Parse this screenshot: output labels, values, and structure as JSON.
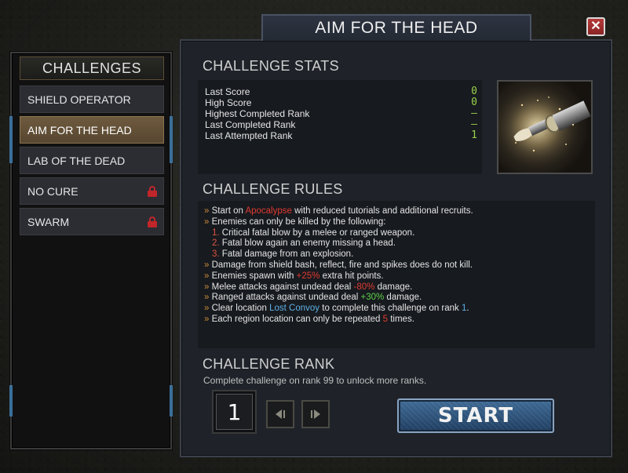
{
  "window": {
    "title": "AIM FOR THE HEAD",
    "close_label": "✕"
  },
  "sidebar": {
    "header": "CHALLENGES",
    "items": [
      {
        "label": "SHIELD OPERATOR",
        "locked": false,
        "active": false
      },
      {
        "label": "AIM FOR THE HEAD",
        "locked": false,
        "active": true
      },
      {
        "label": "LAB OF THE DEAD",
        "locked": false,
        "active": false
      },
      {
        "label": "NO CURE",
        "locked": true,
        "active": false
      },
      {
        "label": "SWARM",
        "locked": true,
        "active": false
      }
    ]
  },
  "stats": {
    "title": "CHALLENGE STATS",
    "rows": [
      {
        "label": "Last Score",
        "value": "0"
      },
      {
        "label": "High Score",
        "value": "0"
      },
      {
        "label": "Highest Completed Rank",
        "value": "–"
      },
      {
        "label": "Last Completed Rank",
        "value": "–"
      },
      {
        "label": "Last Attempted Rank",
        "value": "1"
      }
    ],
    "image_icon": "bullet-icon"
  },
  "rules": {
    "title": "CHALLENGE RULES",
    "bullet": "»",
    "r1": {
      "a": "Start on ",
      "b": "Apocalypse",
      "c": " with reduced tutorials and additional recruits."
    },
    "r2": "Enemies can only be killed by the following:",
    "sub1": {
      "n": "1.",
      "t": "Critical fatal blow by a melee or ranged weapon."
    },
    "sub2": {
      "n": "2.",
      "t": "Fatal blow again an enemy missing a head."
    },
    "sub3": {
      "n": "3.",
      "t": "Fatal damage from an explosion."
    },
    "r3": "Damage from shield bash, reflect, fire and spikes does do not kill.",
    "r4": {
      "a": "Enemies spawn with ",
      "b": "+25%",
      "c": " extra hit points."
    },
    "r5": {
      "a": "Melee attacks against undead deal ",
      "b": "-80%",
      "c": " damage."
    },
    "r6": {
      "a": "Ranged attacks against undead deal ",
      "b": "+30%",
      "c": " damage."
    },
    "r7": {
      "a": "Clear location ",
      "b": "Lost Convoy",
      "c": " to complete this challenge on rank ",
      "d": "1",
      "e": "."
    },
    "r8": {
      "a": "Each region location can only be repeated ",
      "b": "5",
      "c": " times."
    }
  },
  "rank": {
    "title": "CHALLENGE RANK",
    "description": "Complete challenge on rank 99 to unlock more ranks.",
    "value": "1",
    "prev_icon": "chevron-left-icon",
    "next_icon": "chevron-right-icon"
  },
  "start_label": "START",
  "colors": {
    "accent_red": "#e03a30",
    "accent_green": "#5fd14a",
    "accent_blue": "#5fb1e6",
    "start_blue": "#3f6b96",
    "active_item": "#6e5a3e"
  }
}
